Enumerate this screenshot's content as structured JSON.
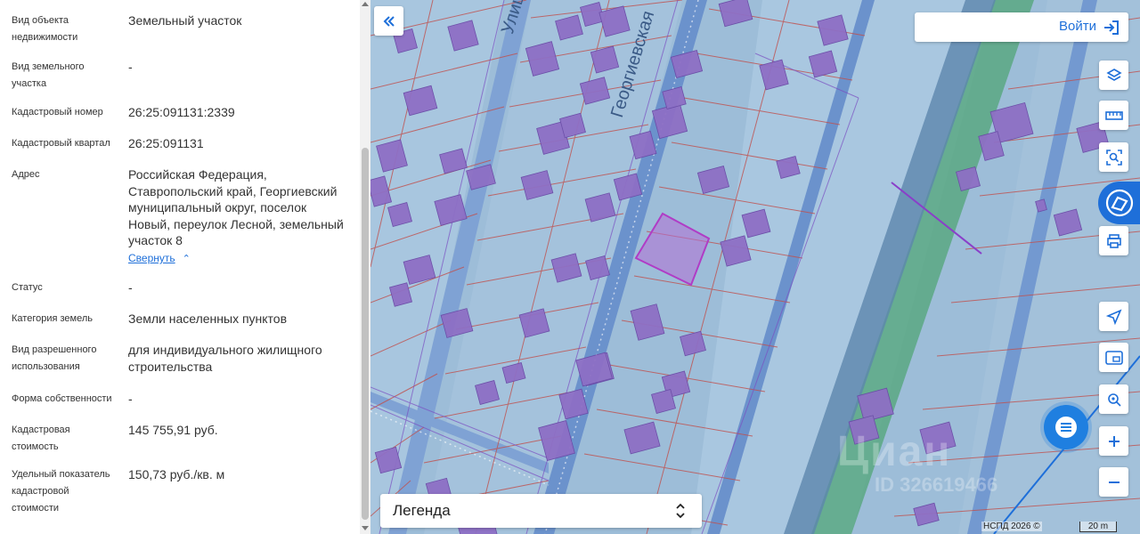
{
  "info_panel": {
    "rows": [
      {
        "label": "Вид объекта недвижимости",
        "value": "Земельный участок"
      },
      {
        "label": "Вид земельного участка",
        "value": "-"
      },
      {
        "label": "Кадастровый номер",
        "value": "26:25:091131:2339"
      },
      {
        "label": "Кадастровый квартал",
        "value": "26:25:091131"
      },
      {
        "label": "Адрес",
        "value": "Российская Федерация, Ставропольский край, Георгиевский муниципальный округ, поселок Новый, переулок Лесной, земельный участок 8"
      },
      {
        "label": "Статус",
        "value": "-"
      },
      {
        "label": "Категория земель",
        "value": "Земли населенных пунктов"
      },
      {
        "label": "Вид разрешенного использования",
        "value": "для индивидуального жилищного строительства"
      },
      {
        "label": "Форма собственности",
        "value": "-"
      },
      {
        "label": "Кадастровая стоимость",
        "value": "145 755,91 руб."
      },
      {
        "label": "Удельный показатель кадастровой стоимости",
        "value": "150,73 руб./кв. м"
      }
    ],
    "collapse_label": "Свернуть"
  },
  "map": {
    "login_label": "Войти",
    "legend_label": "Легенда",
    "street_labels": [
      "Улица",
      "Георгиевская"
    ],
    "attribution": "НСПД 2026 ©",
    "scale_label": "20 m",
    "watermark_text": "Циан",
    "watermark_id": "ID 326619466",
    "toolbar_icons": [
      "layers-icon",
      "ruler-icon",
      "area-select-icon",
      "egrn-logo-icon",
      "print-icon",
      "locate-icon",
      "minimap-icon",
      "geo-search-icon",
      "zoom-in-icon",
      "zoom-out-icon"
    ]
  },
  "colors": {
    "accent": "#1e6fd9",
    "map_background": "#9dbdd8",
    "parcel_outline": "#c0504d",
    "building_fill": "#8e6fc4",
    "selected_parcel": "#b03cc6",
    "road": "#6b92cc",
    "green_strip": "#5aa882"
  }
}
